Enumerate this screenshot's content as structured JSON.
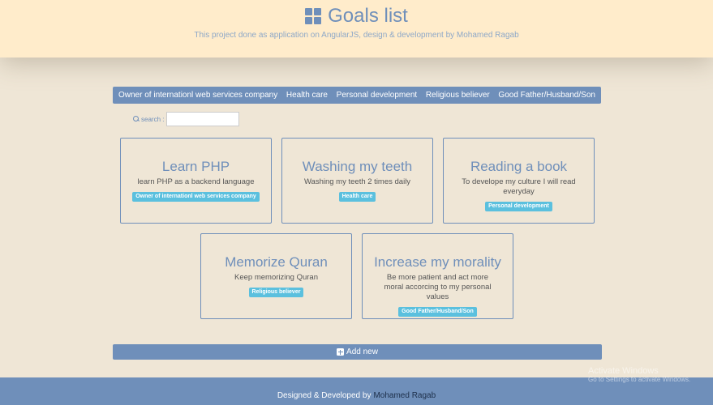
{
  "header": {
    "icon": "th-large-icon",
    "title": "Goals list",
    "subtitle": "This project done as application on AngularJS, design & development by Mohamed Ragab"
  },
  "nav": {
    "items": [
      {
        "label": "Owner of internationl web services company"
      },
      {
        "label": "Health care"
      },
      {
        "label": "Personal development"
      },
      {
        "label": "Religious believer"
      },
      {
        "label": "Good Father/Husband/Son"
      }
    ]
  },
  "search": {
    "label": "search :",
    "icon": "search-icon",
    "value": ""
  },
  "goals": [
    {
      "title": "Learn PHP",
      "description": "learn PHP as a backend language",
      "category": "Owner of internationl web services company"
    },
    {
      "title": "Washing my teeth",
      "description": "Washing my teeth 2 times daily",
      "category": "Health care"
    },
    {
      "title": "Reading a book",
      "description": "To develope my culture I will read everyday",
      "category": "Personal development"
    },
    {
      "title": "Memorize Quran",
      "description": "Keep memorizing Quran",
      "category": "Religious believer"
    },
    {
      "title": "Increase my morality",
      "description": "Be more patient and act more moral accorcing to my personal values",
      "category": "Good Father/Husband/Son"
    }
  ],
  "add_button": {
    "label": "Add new",
    "icon": "plus-square-icon"
  },
  "footer": {
    "text": "Designed & Developed by",
    "link": "Mohamed Ragab"
  },
  "watermark": {
    "title": "Activate Windows",
    "subtitle": "Go to Settings to activate Windows."
  },
  "colors": {
    "accent": "#6f8fba",
    "badge": "#5bc0de",
    "header_bg": "#ffeccb",
    "page_bg": "#efe6d6"
  }
}
